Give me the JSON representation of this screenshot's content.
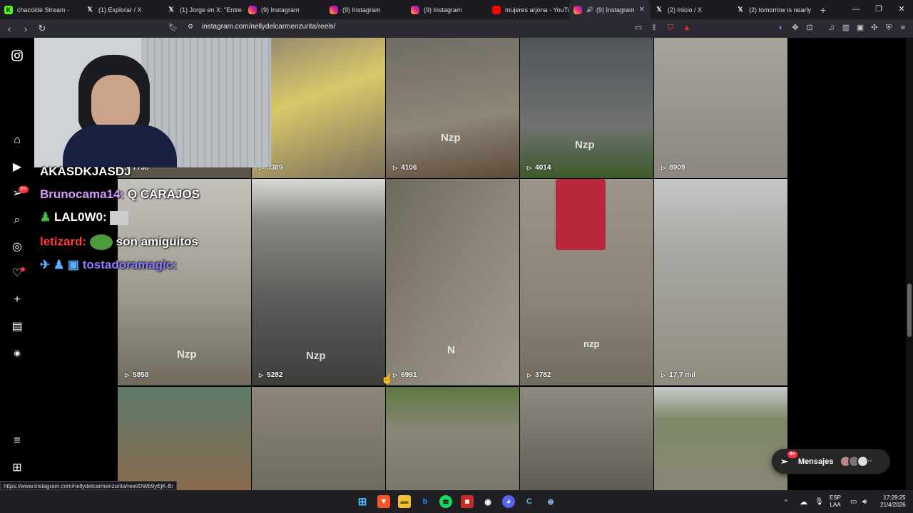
{
  "browser": {
    "tabs": [
      {
        "title": "chacoide Stream -",
        "icon": "kick-icon"
      },
      {
        "title": "(1) Explorar / X",
        "icon": "x-icon"
      },
      {
        "title": "(1) Jorge en X: \"Entre n",
        "icon": "x-icon"
      },
      {
        "title": "(9) Instagram",
        "icon": "instagram-icon"
      },
      {
        "title": "(9) Instagram",
        "icon": "instagram-icon"
      },
      {
        "title": "(9) Instagram",
        "icon": "instagram-icon"
      },
      {
        "title": "mujeres arjona - YouTu",
        "icon": "youtube-icon"
      },
      {
        "title": "(9) Instagram",
        "icon": "instagram-icon",
        "active": true
      },
      {
        "title": "(2) Inicio / X",
        "icon": "x-icon"
      },
      {
        "title": "(2) tomorrow is nearly",
        "icon": "x-icon"
      }
    ],
    "url": "instagram.com/nellydelcarmenzurita/reels/",
    "status_url": "https://www.instagram.com/nellydelcarmenzurita/reel/DWb9yEjK-B/"
  },
  "sidebar": {
    "notifications_badge": "9+"
  },
  "reels": {
    "row1": [
      {
        "views": "7738",
        "watermark": ""
      },
      {
        "views": "5389",
        "watermark": ""
      },
      {
        "views": "4106",
        "watermark": "Nzp"
      },
      {
        "views": "4014",
        "watermark": "Nzp"
      },
      {
        "views": "8909",
        "watermark": ""
      }
    ],
    "row2": [
      {
        "views": "5858",
        "watermark": "Nzp"
      },
      {
        "views": "5282",
        "watermark": "Nzp"
      },
      {
        "views": "6991",
        "watermark": "N"
      },
      {
        "views": "3782",
        "watermark": "nzp"
      },
      {
        "views": "17,7 mil",
        "watermark": ""
      }
    ]
  },
  "chat": {
    "lines": [
      {
        "user": "AKASDKJASDJ",
        "msg": "",
        "color": "#ffffff"
      },
      {
        "user": "Brunocama14:",
        "msg": "Q CARAJOS",
        "color": "#d39bff"
      },
      {
        "user": "LAL0W0:",
        "msg": "",
        "color": "#ffffff"
      },
      {
        "user": "letizard:",
        "msg": "son amiguitos",
        "color": "#ff3b3b"
      },
      {
        "user": "tostadoramagic:",
        "msg": "",
        "color": "#8a7bff"
      }
    ]
  },
  "messages": {
    "label": "Mensajes",
    "badge": "9+"
  },
  "taskbar": {
    "lang": "ESP",
    "region": "LAA",
    "time": "17:29:25",
    "date": "21/4/2026"
  }
}
